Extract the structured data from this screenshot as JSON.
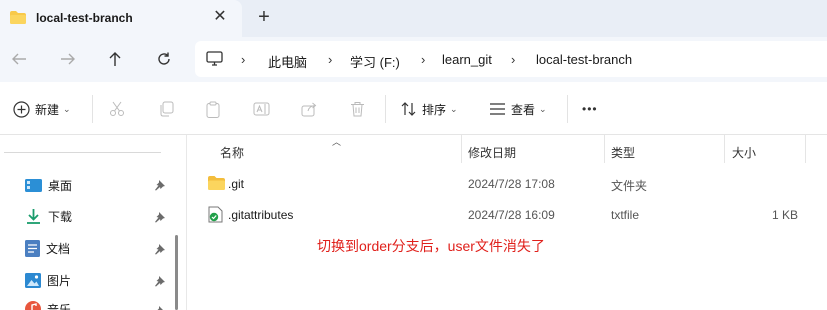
{
  "tab": {
    "title": "local-test-branch",
    "close_glyph": "✕",
    "new_tab_glyph": "+"
  },
  "breadcrumb": [
    "此电脑",
    "学习 (F:)",
    "learn_git",
    "local-test-branch"
  ],
  "commands": {
    "new_label": "新建",
    "sort_label": "排序",
    "view_label": "查看",
    "more_glyph": "•••"
  },
  "sidebar": {
    "items": [
      {
        "label": "桌面",
        "icon": "desktop-icon"
      },
      {
        "label": "下载",
        "icon": "download-icon"
      },
      {
        "label": "文档",
        "icon": "document-icon"
      },
      {
        "label": "图片",
        "icon": "picture-icon"
      },
      {
        "label": "音乐",
        "icon": "music-icon"
      }
    ]
  },
  "columns": {
    "name": "名称",
    "modified": "修改日期",
    "type": "类型",
    "size": "大小"
  },
  "files": [
    {
      "name": ".git",
      "modified": "2024/7/28 17:08",
      "type": "文件夹",
      "size": "",
      "icon": "folder-icon"
    },
    {
      "name": ".gitattributes",
      "modified": "2024/7/28 16:09",
      "type": "txtfile",
      "size": "1 KB",
      "icon": "git-file-icon"
    }
  ],
  "annotation": "切换到order分支后，user文件消失了",
  "colors": {
    "accent": "#0067c0",
    "folder": "#f8c94a",
    "annotation": "#e0201b"
  }
}
